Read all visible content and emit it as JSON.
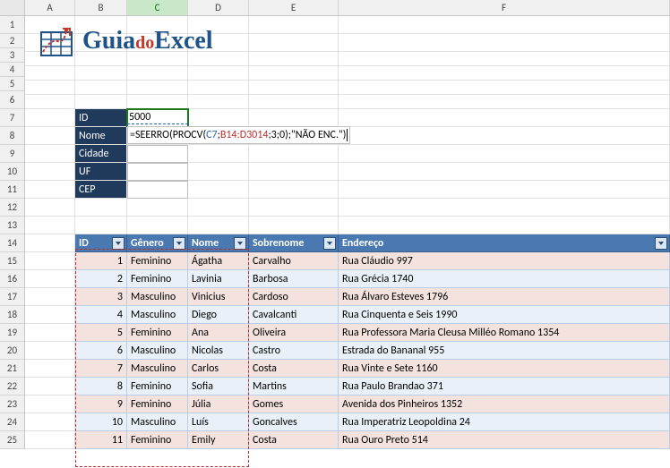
{
  "columns": [
    "A",
    "B",
    "C",
    "D",
    "E",
    "F"
  ],
  "rows": [
    "1",
    "2",
    "3",
    "4",
    "5",
    "6",
    "7",
    "8",
    "9",
    "10",
    "11",
    "12",
    "13",
    "14",
    "15",
    "16",
    "17",
    "18",
    "19",
    "20",
    "21",
    "22",
    "23",
    "24",
    "25"
  ],
  "selected_col": "C",
  "logo": {
    "brand1": "Guia",
    "brand2": "do",
    "brand3": "Excel"
  },
  "lookup": {
    "labels": {
      "id": "ID",
      "nome": "Nome",
      "cidade": "Cidade",
      "uf": "UF",
      "cep": "CEP"
    },
    "values": {
      "id": "5000"
    }
  },
  "formula": {
    "prefix": "=",
    "fn1": "SEERRO",
    "open1": "(",
    "fn2": "PROCV",
    "open2": "(",
    "ref1": "C7",
    "sep1": ";",
    "ref2": "B14:D3014",
    "sep2": ";",
    "arg3": "3",
    "sep3": ";",
    "arg4": "0",
    "close2": ")",
    "sep4": ";",
    "str": "\"NÃO ENC.\"",
    "close1": ")"
  },
  "table": {
    "headers": {
      "id": "ID",
      "genero": "Gênero",
      "nome": "Nome",
      "sobrenome": "Sobrenome",
      "endereco": "Endereço"
    },
    "rows": [
      {
        "id": "1",
        "genero": "Feminino",
        "nome": "Ágatha",
        "sobrenome": "Carvalho",
        "endereco": "Rua Cláudio 997"
      },
      {
        "id": "2",
        "genero": "Feminino",
        "nome": "Lavinia",
        "sobrenome": "Barbosa",
        "endereco": "Rua Grécia 1740"
      },
      {
        "id": "3",
        "genero": "Masculino",
        "nome": "Vinicius",
        "sobrenome": "Cardoso",
        "endereco": "Rua Álvaro Esteves 1796"
      },
      {
        "id": "4",
        "genero": "Masculino",
        "nome": "Diego",
        "sobrenome": "Cavalcanti",
        "endereco": "Rua Cinquenta e Seis 1990"
      },
      {
        "id": "5",
        "genero": "Feminino",
        "nome": "Ana",
        "sobrenome": "Oliveira",
        "endereco": "Rua Professora Maria Cleusa Milléo Romano 1354"
      },
      {
        "id": "6",
        "genero": "Masculino",
        "nome": "Nicolas",
        "sobrenome": "Castro",
        "endereco": "Estrada do Bananal 955"
      },
      {
        "id": "7",
        "genero": "Masculino",
        "nome": "Carlos",
        "sobrenome": "Costa",
        "endereco": "Rua Vinte e Sete 1160"
      },
      {
        "id": "8",
        "genero": "Feminino",
        "nome": "Sofia",
        "sobrenome": "Martins",
        "endereco": "Rua Paulo Brandao 371"
      },
      {
        "id": "9",
        "genero": "Feminino",
        "nome": "Júlia",
        "sobrenome": "Gomes",
        "endereco": "Avenida dos Pinheiros 1352"
      },
      {
        "id": "10",
        "genero": "Masculino",
        "nome": "Luís",
        "sobrenome": "Goncalves",
        "endereco": "Rua Imperatriz Leopoldina 24"
      },
      {
        "id": "11",
        "genero": "Feminino",
        "nome": "Emily",
        "sobrenome": "Costa",
        "endereco": "Rua Ouro Preto 514"
      }
    ]
  }
}
